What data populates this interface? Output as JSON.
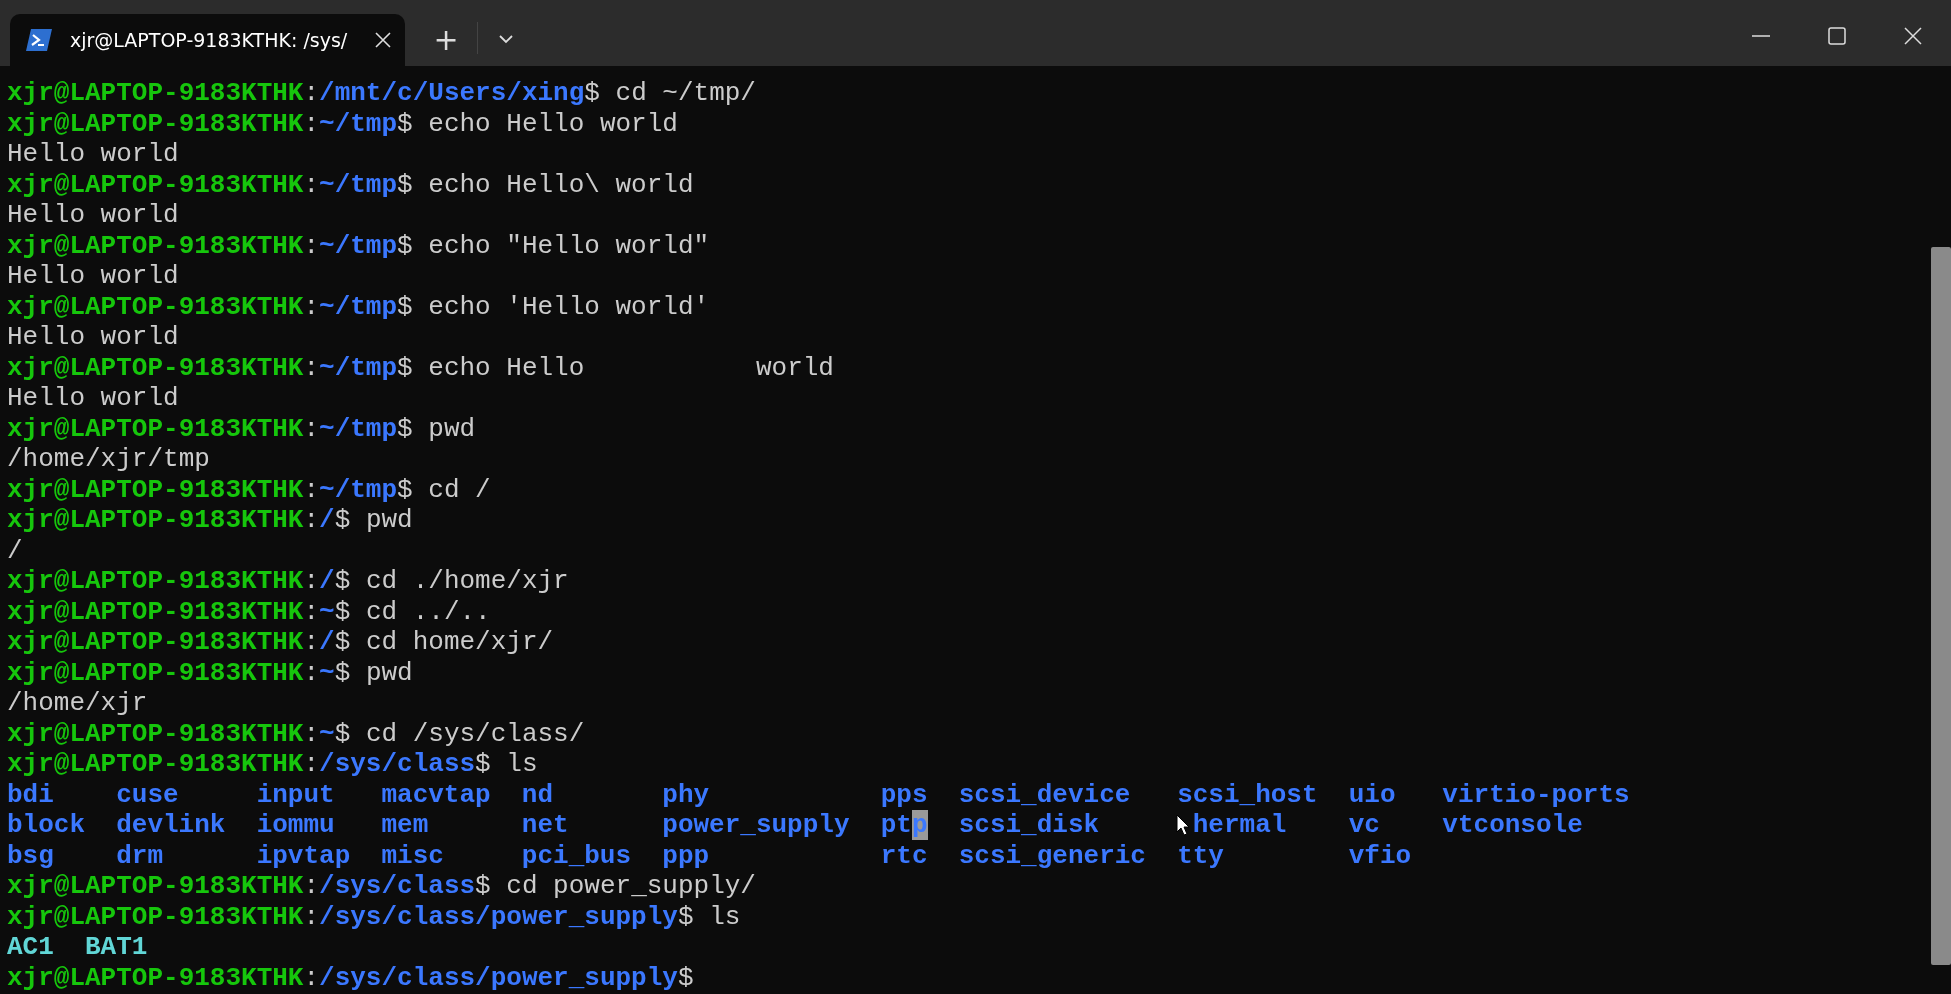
{
  "tab": {
    "title": "xjr@LAPTOP-9183KTHK: /sys/",
    "selected": true
  },
  "new_tab": "+",
  "lines": [
    {
      "kind": "prompt",
      "host": "xjr@LAPTOP-9183KTHK",
      "colon": ":",
      "path": "/mnt/c/Users/xing",
      "sign": "$",
      "command": "cd ~/tmp/"
    },
    {
      "kind": "prompt",
      "host": "xjr@LAPTOP-9183KTHK",
      "colon": ":",
      "path": "~/tmp",
      "sign": "$",
      "command": "echo Hello world"
    },
    {
      "kind": "output",
      "text": "Hello world"
    },
    {
      "kind": "prompt",
      "host": "xjr@LAPTOP-9183KTHK",
      "colon": ":",
      "path": "~/tmp",
      "sign": "$",
      "command": "echo Hello\\ world"
    },
    {
      "kind": "output",
      "text": "Hello world"
    },
    {
      "kind": "prompt",
      "host": "xjr@LAPTOP-9183KTHK",
      "colon": ":",
      "path": "~/tmp",
      "sign": "$",
      "command": "echo \"Hello world\""
    },
    {
      "kind": "output",
      "text": "Hello world"
    },
    {
      "kind": "prompt",
      "host": "xjr@LAPTOP-9183KTHK",
      "colon": ":",
      "path": "~/tmp",
      "sign": "$",
      "command": "echo 'Hello world'"
    },
    {
      "kind": "output",
      "text": "Hello world"
    },
    {
      "kind": "prompt",
      "host": "xjr@LAPTOP-9183KTHK",
      "colon": ":",
      "path": "~/tmp",
      "sign": "$",
      "command": "echo Hello           world"
    },
    {
      "kind": "output",
      "text": "Hello world"
    },
    {
      "kind": "prompt",
      "host": "xjr@LAPTOP-9183KTHK",
      "colon": ":",
      "path": "~/tmp",
      "sign": "$",
      "command": "pwd"
    },
    {
      "kind": "output",
      "text": "/home/xjr/tmp"
    },
    {
      "kind": "prompt",
      "host": "xjr@LAPTOP-9183KTHK",
      "colon": ":",
      "path": "~/tmp",
      "sign": "$",
      "command": "cd /"
    },
    {
      "kind": "prompt",
      "host": "xjr@LAPTOP-9183KTHK",
      "colon": ":",
      "path": "/",
      "sign": "$",
      "command": "pwd"
    },
    {
      "kind": "output",
      "text": "/"
    },
    {
      "kind": "prompt",
      "host": "xjr@LAPTOP-9183KTHK",
      "colon": ":",
      "path": "/",
      "sign": "$",
      "command": "cd ./home/xjr"
    },
    {
      "kind": "prompt",
      "host": "xjr@LAPTOP-9183KTHK",
      "colon": ":",
      "path": "~",
      "sign": "$",
      "command": "cd ../.."
    },
    {
      "kind": "prompt",
      "host": "xjr@LAPTOP-9183KTHK",
      "colon": ":",
      "path": "/",
      "sign": "$",
      "command": "cd home/xjr/"
    },
    {
      "kind": "prompt",
      "host": "xjr@LAPTOP-9183KTHK",
      "colon": ":",
      "path": "~",
      "sign": "$",
      "command": "pwd"
    },
    {
      "kind": "output",
      "text": "/home/xjr"
    },
    {
      "kind": "prompt",
      "host": "xjr@LAPTOP-9183KTHK",
      "colon": ":",
      "path": "~",
      "sign": "$",
      "command": "cd /sys/class/"
    },
    {
      "kind": "prompt",
      "host": "xjr@LAPTOP-9183KTHK",
      "colon": ":",
      "path": "/sys/class",
      "sign": "$",
      "command": "ls"
    },
    {
      "kind": "listing",
      "color": "#3b78ff",
      "columns": [
        [
          {
            "text": "bdi"
          },
          {
            "text": "block"
          },
          {
            "text": "bsg"
          }
        ],
        [
          {
            "text": "cuse"
          },
          {
            "text": "devlink"
          },
          {
            "text": "drm"
          }
        ],
        [
          {
            "text": "input"
          },
          {
            "text": "iommu"
          },
          {
            "text": "ipvtap"
          }
        ],
        [
          {
            "text": "macvtap"
          },
          {
            "text": "mem"
          },
          {
            "text": "misc"
          }
        ],
        [
          {
            "text": "nd"
          },
          {
            "text": "net"
          },
          {
            "text": "pci_bus"
          }
        ],
        [
          {
            "text": "phy"
          },
          {
            "text": "power_supply"
          },
          {
            "text": "ppp"
          }
        ],
        [
          {
            "text": "pps"
          },
          {
            "text": "ptp",
            "cursor": true
          },
          {
            "text": "rtc"
          }
        ],
        [
          {
            "text": "scsi_device"
          },
          {
            "text": "scsi_disk"
          },
          {
            "text": "scsi_generic"
          }
        ],
        [
          {
            "text": "scsi_host"
          },
          {
            "text": "hermal",
            "pointer": true
          },
          {
            "text": "tty"
          }
        ],
        [
          {
            "text": "uio"
          },
          {
            "text": "vc"
          },
          {
            "text": "vfio"
          }
        ],
        [
          {
            "text": "virtio-ports"
          },
          {
            "text": "vtconsole"
          }
        ]
      ]
    },
    {
      "kind": "prompt",
      "host": "xjr@LAPTOP-9183KTHK",
      "colon": ":",
      "path": "/sys/class",
      "sign": "$",
      "command": "cd power_supply/"
    },
    {
      "kind": "prompt",
      "host": "xjr@LAPTOP-9183KTHK",
      "colon": ":",
      "path": "/sys/class/power_supply",
      "sign": "$",
      "command": "ls"
    },
    {
      "kind": "listing",
      "color": "#61d6d6",
      "columns": [
        [
          {
            "text": "AC1"
          }
        ],
        [
          {
            "text": "BAT1"
          }
        ]
      ]
    },
    {
      "kind": "prompt",
      "host": "xjr@LAPTOP-9183KTHK",
      "colon": ":",
      "path": "/sys/class/power_supply",
      "sign": "$"
    }
  ]
}
